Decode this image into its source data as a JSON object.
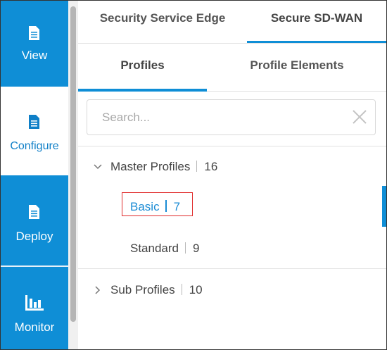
{
  "nav": {
    "items": [
      {
        "label": "View",
        "icon": "document-icon"
      },
      {
        "label": "Configure",
        "icon": "document-icon"
      },
      {
        "label": "Deploy",
        "icon": "document-icon"
      },
      {
        "label": "Monitor",
        "icon": "bar-chart-icon"
      }
    ],
    "active": "Configure",
    "colors": {
      "accent": "#0f8ed6",
      "active_bg": "#ffffff"
    }
  },
  "tabs_top": [
    {
      "label": "Security Service Edge"
    },
    {
      "label": "Secure SD-WAN",
      "selected": true
    }
  ],
  "tabs_sub": [
    {
      "label": "Profiles",
      "selected": true
    },
    {
      "label": "Profile Elements"
    }
  ],
  "search": {
    "placeholder": "Search...",
    "value": ""
  },
  "tree": {
    "master": {
      "label": "Master Profiles",
      "count": "16",
      "expanded": true
    },
    "children": [
      {
        "label": "Basic",
        "count": "7",
        "selected": true
      },
      {
        "label": "Standard",
        "count": "9"
      }
    ],
    "sub": {
      "label": "Sub Profiles",
      "count": "10",
      "expanded": false
    }
  }
}
